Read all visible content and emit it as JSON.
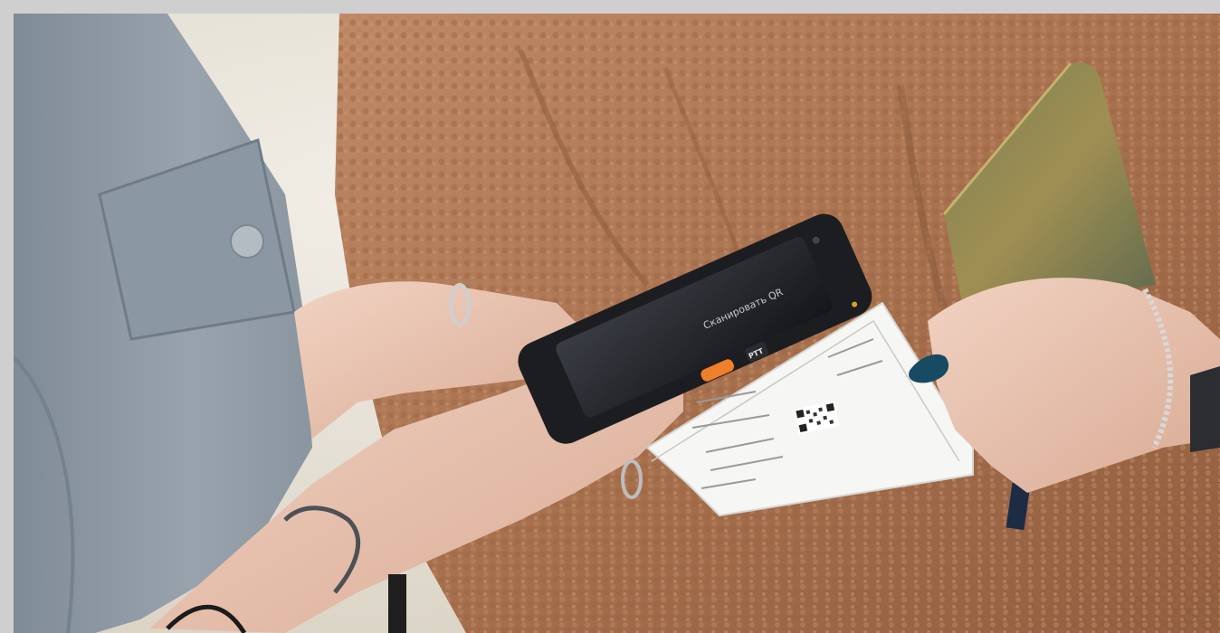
{
  "device": {
    "ptt_label": "PTT",
    "screen_text": "Сканировать QR"
  },
  "colors": {
    "sleeve": "#8e9aa5",
    "coat": "#b07a56",
    "phone_body": "#1c1d20",
    "orange_nail": "#f07f2a",
    "teal_nail": "#174a63",
    "wallet": "#8c7e4d",
    "paper": "#f6f6f4",
    "background": "#ece8de"
  },
  "icons": {
    "qr_code": "qr-code-icon"
  }
}
